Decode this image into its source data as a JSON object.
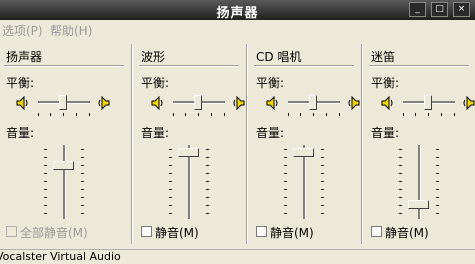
{
  "window": {
    "title": "扬声器",
    "minimize": "_",
    "maximize": "□",
    "close": "×"
  },
  "menu": {
    "options": "选项(P)",
    "help": "帮助(H)"
  },
  "channels": [
    {
      "name": "扬声器",
      "balance_label": "平衡:",
      "volume_label": "音量:",
      "mute_label": "全部静音(M)",
      "mute_checked": false,
      "mute_enabled": false,
      "volume_level": 0.75
    },
    {
      "name": "波形",
      "balance_label": "平衡:",
      "volume_label": "音量:",
      "mute_label": "静音(M)",
      "mute_checked": false,
      "mute_enabled": true,
      "volume_level": 0.95
    },
    {
      "name": "CD 唱机",
      "balance_label": "平衡:",
      "volume_label": "音量:",
      "mute_label": "静音(M)",
      "mute_checked": false,
      "mute_enabled": true,
      "volume_level": 0.95
    },
    {
      "name": "迷笛",
      "balance_label": "平衡:",
      "volume_label": "音量:",
      "mute_label": "静音(M)",
      "mute_checked": false,
      "mute_enabled": true,
      "volume_level": 0.15
    }
  ],
  "status": {
    "device": "Vocalster Virtual Audio"
  },
  "icons": {
    "speaker_left": "speaker-left-icon",
    "speaker_right": "speaker-right-icon"
  }
}
